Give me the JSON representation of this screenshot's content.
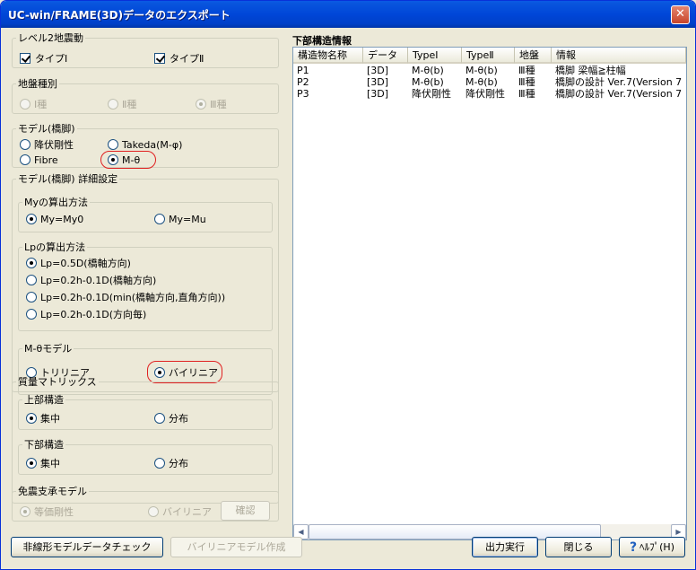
{
  "window": {
    "title": "UC-win/FRAME(3D)データのエクスポート",
    "close_glyph": "✕"
  },
  "level2": {
    "legend": "レベル2地震動",
    "opt1": "タイプⅠ",
    "opt2": "タイプⅡ"
  },
  "ground": {
    "legend": "地盤種別",
    "opt1": "Ⅰ種",
    "opt2": "Ⅱ種",
    "opt3": "Ⅲ種"
  },
  "model": {
    "legend": "モデル(橋脚)",
    "opt1": "降伏剛性",
    "opt2": "Takeda(M-φ)",
    "opt3": "Fibre",
    "opt4": "M-θ"
  },
  "detail": {
    "legend": "モデル(橋脚) 詳細設定",
    "my": {
      "legend": "Myの算出方法",
      "opt1": "My=My0",
      "opt2": "My=Mu"
    },
    "lp": {
      "legend": "Lpの算出方法",
      "opt1": "Lp=0.5D(橋軸方向)",
      "opt2": "Lp=0.2h-0.1D(橋軸方向)",
      "opt3": "Lp=0.2h-0.1D(min(橋軸方向,直角方向))",
      "opt4": "Lp=0.2h-0.1D(方向毎)"
    },
    "mtheta": {
      "legend": "M-θモデル",
      "opt1": "トリリニア",
      "opt2": "バイリニア"
    }
  },
  "mass": {
    "legend": "質量マトリックス",
    "upper": {
      "legend": "上部構造",
      "opt1": "集中",
      "opt2": "分布"
    },
    "lower": {
      "legend": "下部構造",
      "opt1": "集中",
      "opt2": "分布"
    }
  },
  "isolation": {
    "legend": "免震支承モデル",
    "opt1": "等価剛性",
    "opt2": "バイリニア",
    "confirm_label": "確認"
  },
  "substructure": {
    "title": "下部構造情報",
    "columns": [
      "構造物名称",
      "データ",
      "TypeⅠ",
      "TypeⅡ",
      "地盤",
      "情報"
    ],
    "rows": [
      [
        "P1",
        "[3D]",
        "M-θ(b)",
        "M-θ(b)",
        "Ⅲ種",
        "橋脚 梁幅≧柱幅"
      ],
      [
        "P2",
        "[3D]",
        "M-θ(b)",
        "M-θ(b)",
        "Ⅲ種",
        "橋脚の設計 Ver.7(Version 7"
      ],
      [
        "P3",
        "[3D]",
        "降伏剛性",
        "降伏剛性",
        "Ⅲ種",
        "橋脚の設計 Ver.7(Version 7"
      ]
    ],
    "scroll_left": "◀",
    "scroll_right": "▶"
  },
  "footer": {
    "check_label": "非線形モデルデータチェック",
    "bilinear_label": "バイリニアモデル作成",
    "export_label": "出力実行",
    "close_label": "閉じる",
    "help_icon": "?",
    "help_label": "ﾍﾙﾌﾟ(H)"
  },
  "colors": {
    "titlebar": "#0046d8",
    "face": "#ece9d8",
    "highlight": "#e02020"
  }
}
